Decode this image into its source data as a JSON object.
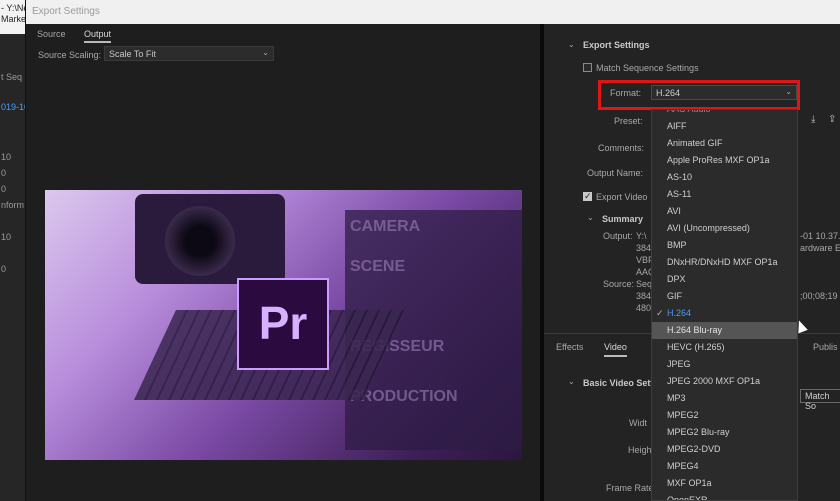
{
  "window": {
    "title": "Export Settings"
  },
  "background_app": {
    "title_fragment": "- Y:\\Ne",
    "menu_fragment": "Marke",
    "fragments": [
      "t Seq",
      "019-10",
      "10",
      "0",
      "0",
      "nform",
      "10",
      "0"
    ]
  },
  "tabs": {
    "source": "Source",
    "output": "Output"
  },
  "source_scaling": {
    "label": "Source Scaling:",
    "value": "Scale To Fit"
  },
  "preview": {
    "clapboard_words": [
      "CAMERA",
      "SCENE",
      "REGISSEUR",
      "PRODUCTION"
    ],
    "logo_text": "Pr"
  },
  "export_settings": {
    "header": "Export Settings",
    "match_sequence": "Match Sequence Settings",
    "format_label": "Format:",
    "format_value": "H.264",
    "preset_label": "Preset:",
    "comments_label": "Comments:",
    "output_name_label": "Output Name:",
    "export_video": "Export Video"
  },
  "summary": {
    "header": "Summary",
    "output_label": "Output:",
    "output_lines": [
      "Y:\\",
      "384",
      "VBF",
      "AAC"
    ],
    "output_right": [
      "-01 10.37.",
      "ardware En"
    ],
    "source_label": "Source:",
    "source_lines": [
      "Seq",
      "384",
      "480"
    ],
    "source_right": ";00;08;19"
  },
  "format_dropdown": {
    "items": [
      "AAC Audio",
      "AIFF",
      "Animated GIF",
      "Apple ProRes MXF OP1a",
      "AS-10",
      "AS-11",
      "AVI",
      "AVI (Uncompressed)",
      "BMP",
      "DNxHR/DNxHD MXF OP1a",
      "DPX",
      "GIF",
      "H.264",
      "H.264 Blu-ray",
      "HEVC (H.265)",
      "JPEG",
      "JPEG 2000 MXF OP1a",
      "MP3",
      "MPEG2",
      "MPEG2 Blu-ray",
      "MPEG2-DVD",
      "MPEG4",
      "MXF OP1a",
      "OpenEXR"
    ],
    "selected": "H.264",
    "hovered": "H.264 Blu-ray"
  },
  "bottom_tabs": {
    "effects": "Effects",
    "video": "Video",
    "publish": "Publis"
  },
  "video_settings": {
    "header": "Basic Video Settin",
    "width": "Widt",
    "height": "Heigh",
    "frame_rate": "Frame Rate",
    "match_button": "Match So"
  },
  "colors": {
    "accent_selected": "#4b9cf5",
    "highlight_box": "#e01515",
    "logo_border": "#c99cff"
  }
}
